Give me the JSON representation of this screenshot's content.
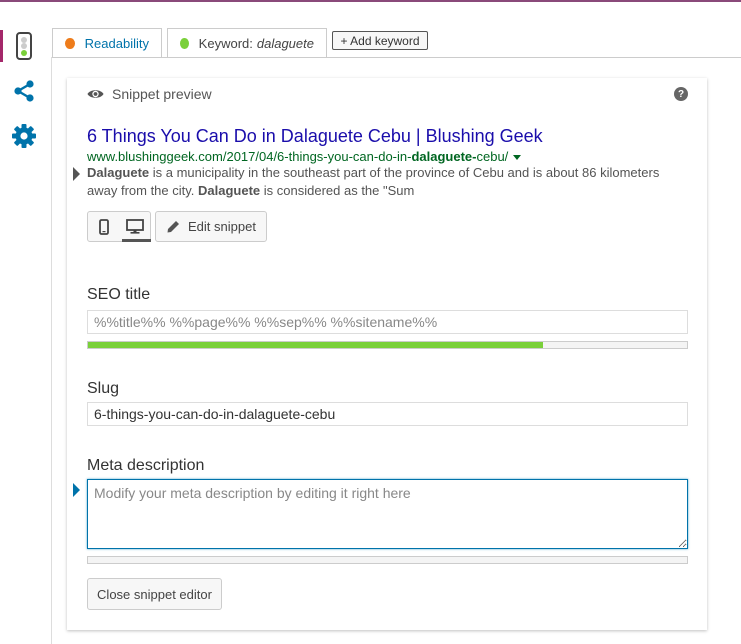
{
  "rail": {
    "items": [
      "readability-analysis",
      "social",
      "advanced-settings"
    ]
  },
  "tabs": {
    "readability": {
      "label": "Readability",
      "dot_color": "#ee7c1b"
    },
    "keyword": {
      "label": "Keyword:",
      "value": "dalaguete",
      "dot_color": "#7ad03a"
    },
    "add_keyword": "+ Add keyword"
  },
  "snippet": {
    "heading": "Snippet preview",
    "help": "?",
    "title": "6 Things You Can Do in Dalaguete Cebu | Blushing Geek",
    "url_prefix": "www.blushinggeek.com/2017/04/6-things-you-can-do-in-",
    "url_bold": "dalaguete-",
    "url_suffix": "cebu/",
    "desc_bold_1": "Dalaguete",
    "desc_text_1": " is a municipality in the southeast part of the province of Cebu and is about 86 kilometers away from the city. ",
    "desc_bold_2": "Dalaguete",
    "desc_text_2": " is considered as the \"Sum",
    "edit_label": "Edit snippet"
  },
  "seo_title": {
    "label": "SEO title",
    "value": "%%title%% %%page%% %%sep%% %%sitename%%",
    "progress": 0.76
  },
  "slug": {
    "label": "Slug",
    "value": "6-things-you-can-do-in-dalaguete-cebu"
  },
  "meta": {
    "label": "Meta description",
    "placeholder": "Modify your meta description by editing it right here",
    "progress": 0
  },
  "close_label": "Close snippet editor",
  "colors": {
    "accent": "#a4286a",
    "link": "#0073aa",
    "good": "#7ad03a",
    "ok": "#ee7c1b"
  }
}
